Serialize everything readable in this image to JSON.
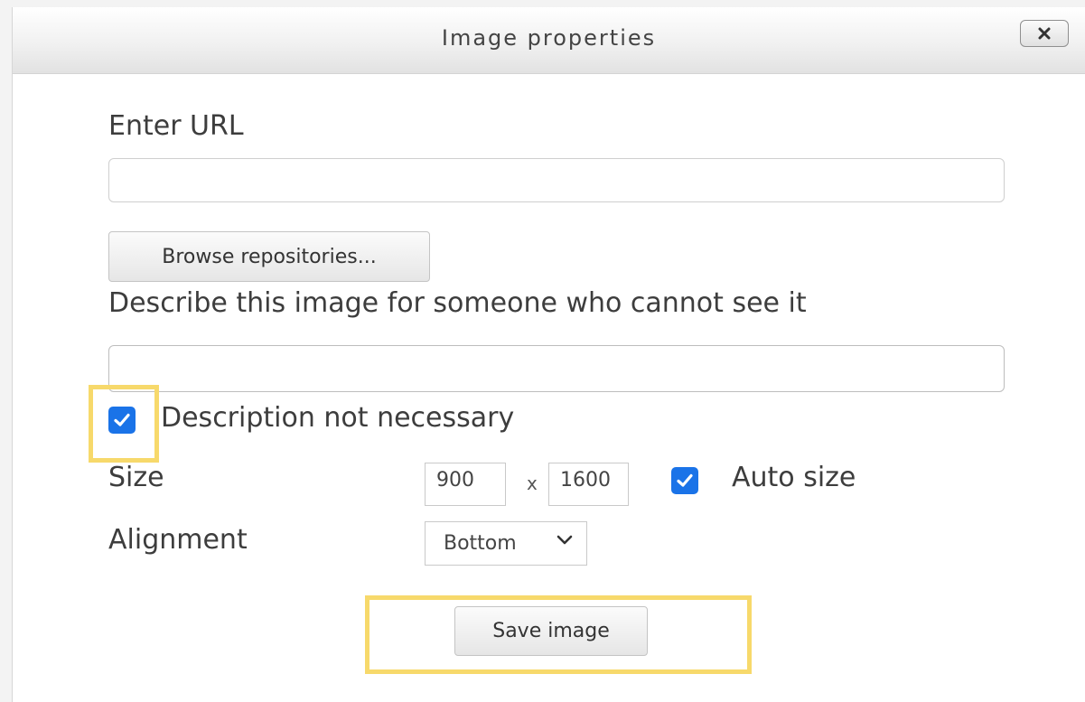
{
  "dialog": {
    "title": "Image properties",
    "close_label": "✕"
  },
  "url": {
    "label": "Enter URL",
    "value": "",
    "placeholder": ""
  },
  "browse_button_label": "Browse repositories...",
  "description": {
    "label": "Describe this image for someone who cannot see it",
    "value": ""
  },
  "description_not_necessary": {
    "label": "Description not necessary",
    "checked": true
  },
  "size": {
    "label": "Size",
    "width": "900",
    "height": "1600",
    "times": "x",
    "auto_size_label": "Auto size",
    "auto_size_checked": true
  },
  "alignment": {
    "label": "Alignment",
    "selected": "Bottom"
  },
  "save_button_label": "Save image",
  "colors": {
    "checkbox": "#1a73e8",
    "highlight": "#f7d96b"
  },
  "icons": {
    "close": "close-icon",
    "checkmark": "checkmark-icon",
    "dropdown": "chevron-down-icon"
  }
}
